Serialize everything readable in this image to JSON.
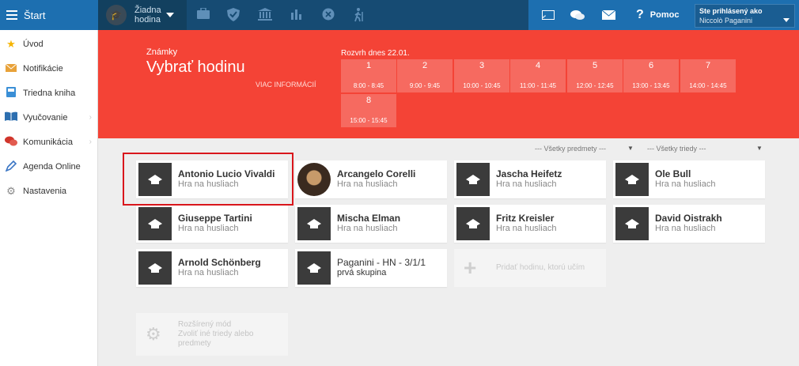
{
  "topbar": {
    "start_label": "Štart",
    "lesson_line1": "Žiadna",
    "lesson_line2": "hodina",
    "icons": [
      "briefcase-icon",
      "shield-check-icon",
      "institution-icon",
      "bar-chart-icon",
      "badge-icon",
      "walking-icon"
    ],
    "help_label": "Pomoc",
    "user_label": "Ste prihlásený ako",
    "user_name": "Niccolò Paganini"
  },
  "sidebar": {
    "items": [
      {
        "label": "Úvod",
        "icon": "star-icon",
        "color": "#f5b400"
      },
      {
        "label": "Notifikácie",
        "icon": "envelope-icon",
        "color": "#e8a23a"
      },
      {
        "label": "Triedna kniha",
        "icon": "book-icon",
        "color": "#3a8fd6"
      },
      {
        "label": "Vyučovanie",
        "icon": "open-book-icon",
        "color": "#2d6fb0",
        "has_sub": true
      },
      {
        "label": "Komunikácia",
        "icon": "chat-icon",
        "color": "#d0352b",
        "has_sub": true
      },
      {
        "label": "Agenda Online",
        "icon": "pen-icon",
        "color": "#3a75c4"
      },
      {
        "label": "Nastavenia",
        "icon": "gear-icon",
        "color": "#888888"
      }
    ]
  },
  "hero": {
    "subtitle": "Známky",
    "title": "Vybrať hodinu",
    "more": "VIAC INFORMÁCIÍ",
    "schedule_title": "Rozvrh dnes 22.01.",
    "slots": [
      {
        "n": "1",
        "time": "8:00 - 8:45"
      },
      {
        "n": "2",
        "time": "9:00 - 9:45"
      },
      {
        "n": "3",
        "time": "10:00 - 10:45"
      },
      {
        "n": "4",
        "time": "11:00 - 11:45"
      },
      {
        "n": "5",
        "time": "12:00 - 12:45"
      },
      {
        "n": "6",
        "time": "13:00 - 13:45"
      },
      {
        "n": "7",
        "time": "14:00 - 14:45"
      },
      {
        "n": "8",
        "time": "15:00 - 15:45"
      }
    ]
  },
  "filters": {
    "subjects": "--- Všetky predmety ---",
    "classes": "--- Všetky triedy ---"
  },
  "cards": [
    {
      "name": "Antonio Lucio Vivaldi",
      "subject": "Hra na husliach"
    },
    {
      "name": "Arcangelo Corelli",
      "subject": "Hra na husliach",
      "photo": true
    },
    {
      "name": "Jascha Heifetz",
      "subject": "Hra na husliach"
    },
    {
      "name": "Ole Bull",
      "subject": "Hra na husliach"
    },
    {
      "name": "Giuseppe Tartini",
      "subject": "Hra na husliach"
    },
    {
      "name": "Mischa Elman",
      "subject": "Hra na husliach"
    },
    {
      "name": "Fritz Kreisler",
      "subject": "Hra na husliach"
    },
    {
      "name": "David Oistrakh",
      "subject": "Hra na husliach"
    },
    {
      "name": "Arnold Schönberg",
      "subject": "Hra na husliach"
    },
    {
      "name": "Paganini - HN - 3/1/1",
      "subject": "prvá skupina"
    }
  ],
  "add_card": {
    "label": "Pridať hodinu, ktorú učím"
  },
  "advanced": {
    "line1": "Rozšírený mód",
    "line2": "Zvoliť iné triedy alebo predmety"
  }
}
